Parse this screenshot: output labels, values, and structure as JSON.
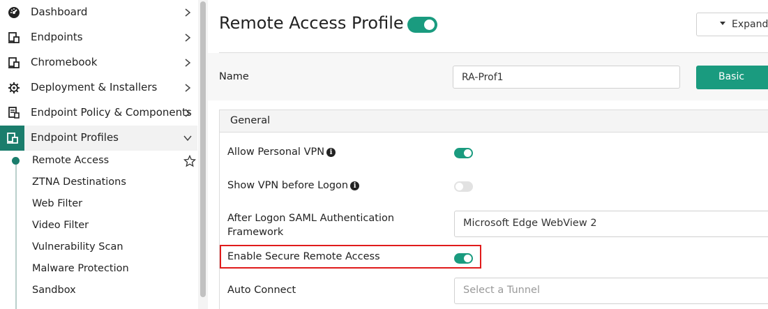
{
  "sidebar": {
    "items": [
      {
        "label": "Dashboard",
        "icon": "dashboard-icon"
      },
      {
        "label": "Endpoints",
        "icon": "endpoints-icon"
      },
      {
        "label": "Chromebook",
        "icon": "chromebook-icon"
      },
      {
        "label": "Deployment & Installers",
        "icon": "gear-icon"
      },
      {
        "label": "Endpoint Policy & Components",
        "icon": "policy-icon"
      },
      {
        "label": "Endpoint Profiles",
        "icon": "profiles-icon"
      }
    ],
    "sub_items": [
      "Remote Access",
      "ZTNA Destinations",
      "Web Filter",
      "Video Filter",
      "Vulnerability Scan",
      "Malware Protection",
      "Sandbox"
    ]
  },
  "header": {
    "title": "Remote Access Profile",
    "expand_label": "Expand"
  },
  "name_row": {
    "label": "Name",
    "value": "RA-Prof1",
    "basic_label": "Basic"
  },
  "general": {
    "title": "General",
    "allow_personal_vpn": "Allow Personal VPN",
    "show_vpn_before_logon": "Show VPN before Logon",
    "saml_line1": "After Logon SAML Authentication",
    "saml_line2": "Framework",
    "saml_value": "Microsoft Edge WebView 2",
    "enable_secure_remote_access": "Enable Secure Remote Access",
    "auto_connect": "Auto Connect",
    "auto_connect_placeholder": "Select a Tunnel"
  },
  "colors": {
    "accent": "#1a9b7f",
    "sidebar_active": "#1a7d6c",
    "highlight": "#e01b1b"
  }
}
